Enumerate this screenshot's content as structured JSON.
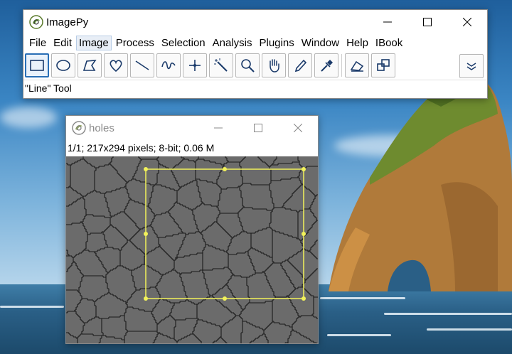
{
  "main_window": {
    "title": "ImagePy",
    "menu": [
      "File",
      "Edit",
      "Image",
      "Process",
      "Selection",
      "Analysis",
      "Plugins",
      "Window",
      "Help",
      "IBook"
    ],
    "active_menu": "Image",
    "tools": [
      {
        "name": "rectangle-tool",
        "icon": "rectangle-icon",
        "selected": true
      },
      {
        "name": "ellipse-tool",
        "icon": "ellipse-icon"
      },
      {
        "name": "polygon-tool",
        "icon": "polygon-icon"
      },
      {
        "name": "freehand-tool",
        "icon": "heart-shape-icon"
      },
      {
        "name": "line-tool",
        "icon": "line-icon"
      },
      {
        "name": "polyline-tool",
        "icon": "curve-icon"
      },
      {
        "name": "point-tool",
        "icon": "crosshair-icon"
      },
      {
        "name": "magic-wand-tool",
        "icon": "magic-wand-icon"
      },
      {
        "name": "zoom-tool",
        "icon": "magnifier-icon"
      },
      {
        "name": "hand-tool",
        "icon": "hand-icon"
      },
      {
        "name": "pencil-tool",
        "icon": "pencil-icon"
      },
      {
        "name": "color-picker-tool",
        "icon": "eyedropper-icon"
      },
      {
        "name": "eraser-tool",
        "icon": "eraser-icon"
      },
      {
        "name": "roi-tool",
        "icon": "overlap-squares-icon"
      }
    ],
    "more_tools_icon": "double-chevron-down-icon",
    "status": "\"Line\" Tool"
  },
  "image_window": {
    "title": "holes",
    "info": "1/1;   217x294 pixels; 8-bit; 0.06 M"
  },
  "colors": {
    "selection": "#f2f25a",
    "image_bg": "#6b6b6b",
    "cell_lines": "#1a1a1a",
    "accent": "#2a6fb6"
  }
}
